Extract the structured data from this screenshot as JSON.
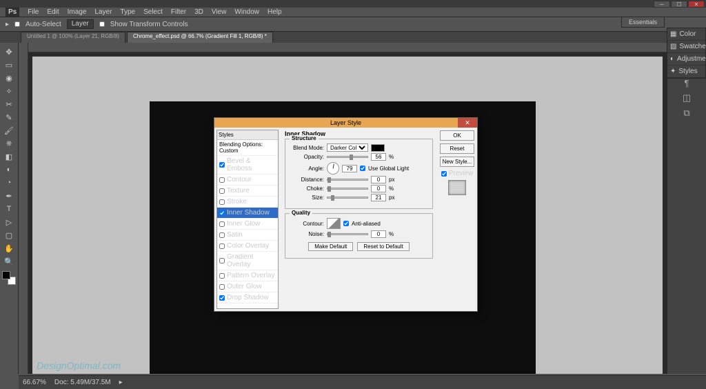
{
  "menu": [
    "File",
    "Edit",
    "Image",
    "Layer",
    "Type",
    "Select",
    "Filter",
    "3D",
    "View",
    "Window",
    "Help"
  ],
  "options": {
    "auto_select": "Auto-Select",
    "layer": "Layer",
    "show": "Show Transform Controls"
  },
  "tabs": [
    {
      "label": "Untitled 1 @ 100% (Layer 21, RGB/8)"
    },
    {
      "label": "Chrome_effect.psd @ 66.7% (Gradient Fill 1, RGB/8) *"
    }
  ],
  "essentials": "Essentials",
  "side_panels": [
    "Color",
    "Swatches",
    "Adjustments",
    "Styles"
  ],
  "footer": {
    "zoom": "66.67%",
    "doc": "Doc: 5.49M/37.5M"
  },
  "watermark": "DesignOptimal.com",
  "dlg": {
    "title": "Layer Style",
    "styles_header": "Styles",
    "blending": "Blending Options: Custom",
    "styles": [
      {
        "name": "Bevel & Emboss",
        "checked": true,
        "sel": false
      },
      {
        "name": "Contour",
        "checked": false,
        "sel": false
      },
      {
        "name": "Texture",
        "checked": false,
        "sel": false
      },
      {
        "name": "Stroke",
        "checked": false,
        "sel": false
      },
      {
        "name": "Inner Shadow",
        "checked": true,
        "sel": true
      },
      {
        "name": "Inner Glow",
        "checked": false,
        "sel": false
      },
      {
        "name": "Satin",
        "checked": false,
        "sel": false
      },
      {
        "name": "Color Overlay",
        "checked": false,
        "sel": false
      },
      {
        "name": "Gradient Overlay",
        "checked": false,
        "sel": false
      },
      {
        "name": "Pattern Overlay",
        "checked": false,
        "sel": false
      },
      {
        "name": "Outer Glow",
        "checked": false,
        "sel": false
      },
      {
        "name": "Drop Shadow",
        "checked": true,
        "sel": false
      }
    ],
    "section": "Inner Shadow",
    "structure": "Structure",
    "blend_mode_l": "Blend Mode:",
    "blend_mode": "Darker Color",
    "opacity_l": "Opacity:",
    "opacity": "56",
    "pct": "%",
    "angle_l": "Angle:",
    "angle": "79",
    "global": "Use Global Light",
    "distance_l": "Distance:",
    "distance": "0",
    "px": "px",
    "choke_l": "Choke:",
    "choke": "0",
    "size_l": "Size:",
    "size": "21",
    "quality": "Quality",
    "contour_l": "Contour:",
    "aa": "Anti-aliased",
    "noise_l": "Noise:",
    "noise": "0",
    "make_default": "Make Default",
    "reset_default": "Reset to Default",
    "ok": "OK",
    "cancel": "Reset",
    "new_style": "New Style...",
    "preview": "Preview"
  }
}
